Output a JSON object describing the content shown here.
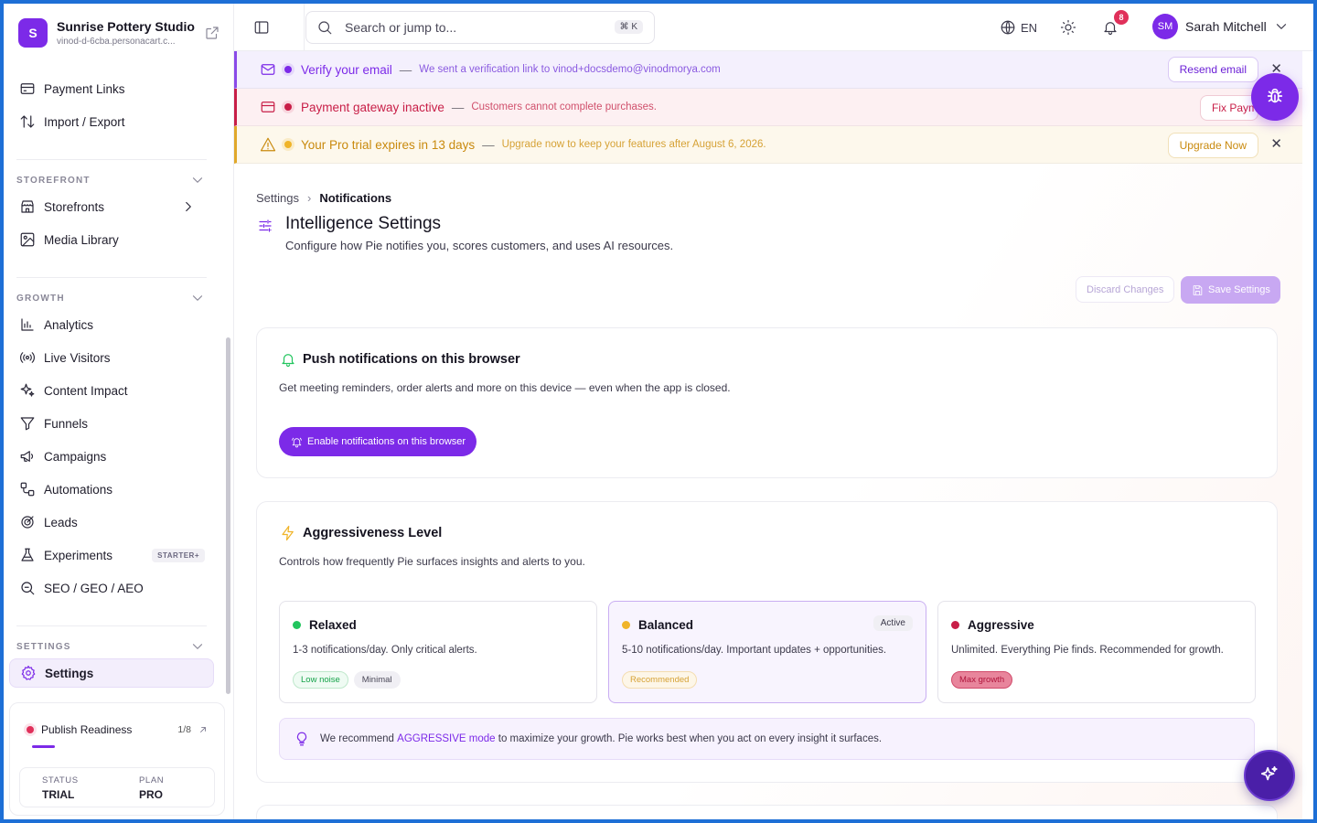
{
  "brand": {
    "initial": "S",
    "name": "Sunrise Pottery Studio",
    "url": "vinod-d-6cba.personacart.c..."
  },
  "sidebar": {
    "top_items": [
      {
        "label": "Payment Links",
        "icon": "credit-card-icon"
      },
      {
        "label": "Import / Export",
        "icon": "arrows-up-down-icon"
      }
    ],
    "sections": {
      "storefront": {
        "label": "STOREFRONT",
        "items": [
          {
            "label": "Storefronts"
          },
          {
            "label": "Media Library"
          }
        ]
      },
      "growth": {
        "label": "GROWTH",
        "items": [
          {
            "label": "Analytics"
          },
          {
            "label": "Live Visitors"
          },
          {
            "label": "Content Impact"
          },
          {
            "label": "Funnels"
          },
          {
            "label": "Campaigns"
          },
          {
            "label": "Automations"
          },
          {
            "label": "Leads"
          },
          {
            "label": "Experiments",
            "badge": "STARTER+"
          },
          {
            "label": "SEO / GEO / AEO"
          }
        ]
      },
      "settings": {
        "label": "SETTINGS",
        "items": [
          {
            "label": "Settings"
          }
        ]
      }
    },
    "readiness": {
      "label": "Publish Readiness",
      "count": "1/8",
      "progress": 0.125,
      "status_label": "STATUS",
      "status_value": "TRIAL",
      "plan_label": "PLAN",
      "plan_value": "PRO"
    }
  },
  "topbar": {
    "search_placeholder": "Search or jump to...",
    "shortcut": "⌘ K",
    "language": "EN",
    "notification_count": "8",
    "user_initials": "SM",
    "user_name": "Sarah Mitchell"
  },
  "banners": {
    "verify": {
      "title": "Verify your email",
      "dash": "—",
      "desc": "We sent a verification link to vinod+docsdemo@vinodmorya.com",
      "button": "Resend email"
    },
    "gateway": {
      "title": "Payment gateway inactive",
      "dash": "—",
      "desc": "Customers cannot complete purchases.",
      "button": "Fix Payment"
    },
    "trial": {
      "title": "Your Pro trial expires in 13 days",
      "dash": "—",
      "desc": "Upgrade now to keep your features after August 6, 2026.",
      "button": "Upgrade Now"
    }
  },
  "page": {
    "breadcrumb_root": "Settings",
    "breadcrumb_current": "Notifications",
    "title": "Intelligence Settings",
    "subtitle": "Configure how Pie notifies you, scores customers, and uses AI resources.",
    "discard_label": "Discard Changes",
    "save_label": "Save Settings"
  },
  "push": {
    "title": "Push notifications on this browser",
    "desc": "Get meeting reminders, order alerts and more on this device — even when the app is closed.",
    "button": "Enable notifications on this browser"
  },
  "aggressiveness": {
    "title": "Aggressiveness Level",
    "desc": "Controls how frequently Pie surfaces insights and alerts to you.",
    "levels": [
      {
        "name": "Relaxed",
        "desc": "1-3 notifications/day. Only critical alerts.",
        "tags": [
          "Low noise",
          "Minimal"
        ]
      },
      {
        "name": "Balanced",
        "desc": "5-10 notifications/day. Important updates + opportunities.",
        "tags": [
          "Recommended"
        ],
        "active_label": "Active"
      },
      {
        "name": "Aggressive",
        "desc": "Unlimited. Everything Pie finds. Recommended for growth.",
        "tags": [
          "Max growth"
        ]
      }
    ],
    "tip_prefix": "We recommend",
    "tip_highlight": "AGGRESSIVE mode",
    "tip_suffix": "to maximize your growth. Pie works best when you act on every insight it surfaces."
  },
  "colors": {
    "accent": "#7c2ae8",
    "danger": "#c81e47",
    "warning": "#f0b429",
    "success": "#22c55e"
  }
}
